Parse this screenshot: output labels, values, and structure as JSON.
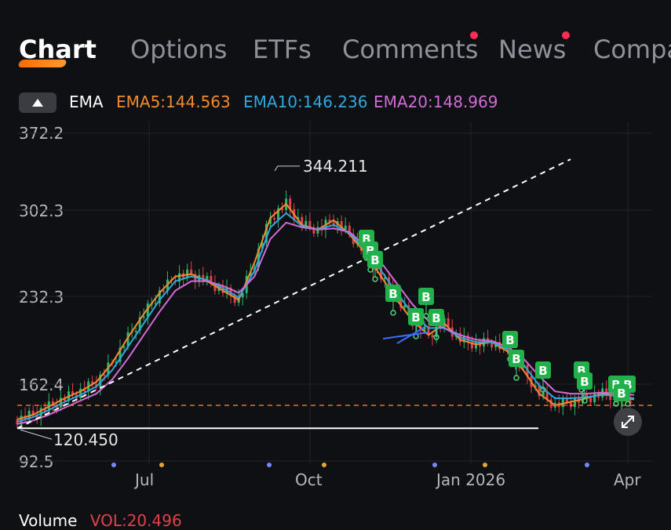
{
  "tabs": [
    {
      "label": "Chart",
      "active": true,
      "dot": false
    },
    {
      "label": "Options",
      "active": false,
      "dot": false
    },
    {
      "label": "ETFs",
      "active": false,
      "dot": false
    },
    {
      "label": "Comments",
      "active": false,
      "dot": true
    },
    {
      "label": "News",
      "active": false,
      "dot": true
    },
    {
      "label": "Compa",
      "active": false,
      "dot": false
    }
  ],
  "indicator": {
    "name": "EMA",
    "ema5": "EMA5:144.563",
    "ema10": "EMA10:146.236",
    "ema20": "EMA20:148.969"
  },
  "colors": {
    "ema5": "#f28a2e",
    "ema10": "#2fa7e0",
    "ema20": "#d36ad8",
    "up": "#2db86a",
    "down": "#e0424b",
    "buy_marker": "#21b14a",
    "dashed_ref": "#e8702a",
    "volume_label": "#e0424b"
  },
  "y_axis": {
    "labels": [
      "372.2",
      "302.3",
      "232.3",
      "162.4",
      "92.5"
    ]
  },
  "x_axis": {
    "labels": [
      "Jul",
      "Oct",
      "Jan 2026",
      "Apr"
    ]
  },
  "annotations": {
    "high": "344.211",
    "low": "120.450",
    "buy_label": "B"
  },
  "volume": {
    "title": "Volume",
    "vol": "VOL:20.496"
  },
  "chart_data": {
    "type": "line",
    "y_range": [
      92.5,
      372.2
    ],
    "x_ticks": [
      "Jul",
      "Oct",
      "Jan 2026",
      "Apr"
    ],
    "high_annotation": 344.211,
    "low_annotation": 120.45,
    "reference_level": 140,
    "series": [
      {
        "name": "EMA5",
        "last": 144.563,
        "values": [
          128,
          132,
          139,
          146,
          152,
          160,
          176,
          198,
          218,
          236,
          250,
          252,
          246,
          238,
          230,
          262,
          300,
          312,
          294,
          290,
          298,
          286,
          270,
          250,
          230,
          212,
          200,
          210,
          196,
          192,
          194,
          186,
          170,
          150,
          140,
          143,
          146,
          150,
          148,
          145
        ]
      },
      {
        "name": "EMA10",
        "last": 146.236,
        "values": [
          126,
          130,
          136,
          143,
          149,
          156,
          170,
          190,
          210,
          230,
          246,
          250,
          247,
          240,
          232,
          255,
          292,
          304,
          293,
          290,
          294,
          287,
          273,
          255,
          236,
          218,
          206,
          206,
          198,
          194,
          194,
          188,
          175,
          157,
          146,
          146,
          147,
          149,
          148,
          146
        ]
      },
      {
        "name": "EMA20",
        "last": 148.969,
        "values": [
          124,
          127,
          132,
          138,
          144,
          150,
          162,
          180,
          200,
          220,
          238,
          246,
          246,
          242,
          236,
          250,
          282,
          296,
          292,
          290,
          291,
          288,
          276,
          262,
          244,
          226,
          212,
          206,
          200,
          196,
          195,
          190,
          180,
          165,
          152,
          150,
          150,
          151,
          150,
          149
        ]
      }
    ]
  }
}
